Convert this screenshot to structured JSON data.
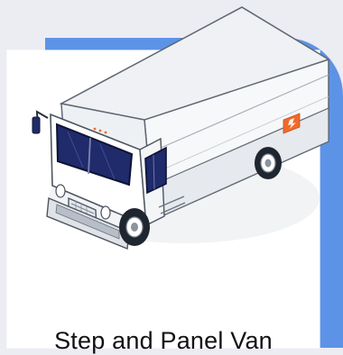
{
  "card": {
    "label": "Step and Panel Van",
    "icon": "step-van-icon"
  },
  "colors": {
    "background": "#ececf3",
    "accent_blue": "#5d93e6",
    "card": "#ffffff",
    "windshield": "#1f2b6b",
    "van_body": "#ffffff",
    "van_outline": "#2f3742",
    "side_badge": "#ef6a2b"
  }
}
